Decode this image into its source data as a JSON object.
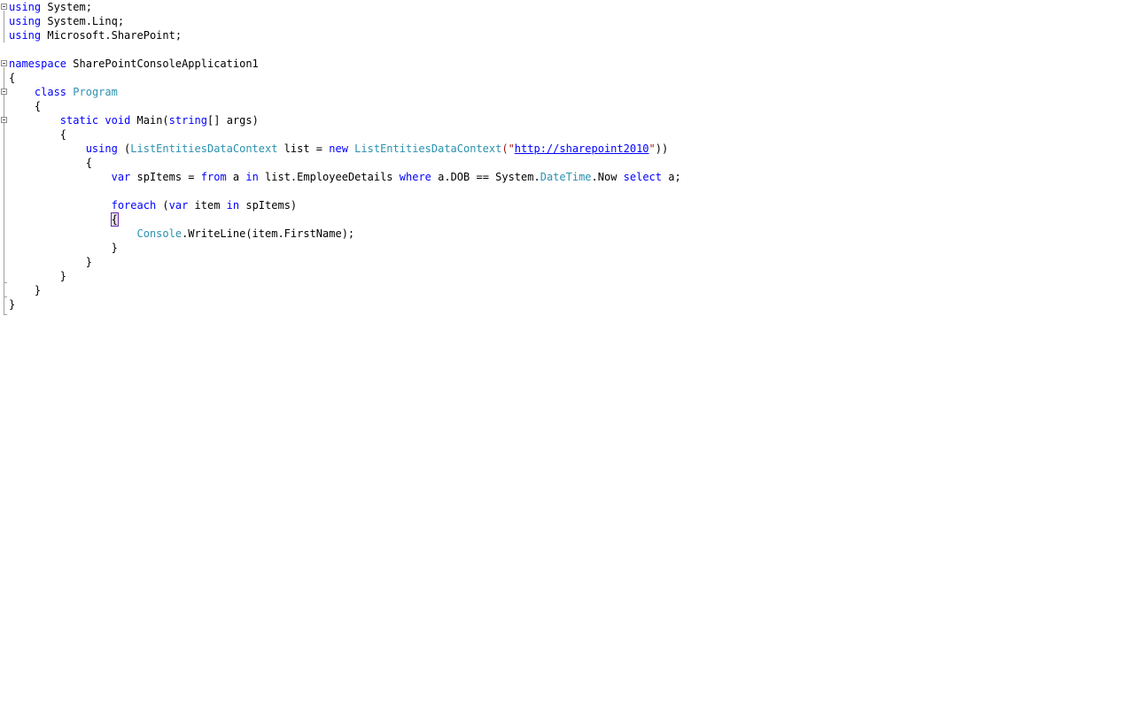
{
  "editor": {
    "lines": [
      {
        "indent": "",
        "tokens": [
          {
            "t": "using",
            "c": "kw"
          },
          {
            "t": " System;",
            "c": ""
          }
        ]
      },
      {
        "indent": "",
        "tokens": [
          {
            "t": "using",
            "c": "kw"
          },
          {
            "t": " System.Linq;",
            "c": ""
          }
        ]
      },
      {
        "indent": "",
        "tokens": [
          {
            "t": "using",
            "c": "kw"
          },
          {
            "t": " Microsoft.SharePoint;",
            "c": ""
          }
        ]
      },
      {
        "indent": "",
        "tokens": []
      },
      {
        "indent": "",
        "tokens": [
          {
            "t": "namespace",
            "c": "kw"
          },
          {
            "t": " SharePointConsoleApplication1",
            "c": ""
          }
        ]
      },
      {
        "indent": "",
        "tokens": [
          {
            "t": "{",
            "c": ""
          }
        ]
      },
      {
        "indent": "    ",
        "tokens": [
          {
            "t": "class",
            "c": "kw"
          },
          {
            "t": " ",
            "c": ""
          },
          {
            "t": "Program",
            "c": "ty"
          }
        ]
      },
      {
        "indent": "    ",
        "tokens": [
          {
            "t": "{",
            "c": ""
          }
        ]
      },
      {
        "indent": "        ",
        "tokens": [
          {
            "t": "static",
            "c": "kw"
          },
          {
            "t": " ",
            "c": ""
          },
          {
            "t": "void",
            "c": "kw"
          },
          {
            "t": " Main(",
            "c": ""
          },
          {
            "t": "string",
            "c": "kw"
          },
          {
            "t": "[] args)",
            "c": ""
          }
        ]
      },
      {
        "indent": "        ",
        "tokens": [
          {
            "t": "{",
            "c": ""
          }
        ]
      },
      {
        "indent": "            ",
        "tokens": [
          {
            "t": "using",
            "c": "kw"
          },
          {
            "t": " (",
            "c": ""
          },
          {
            "t": "ListEntitiesDataContext",
            "c": "ty"
          },
          {
            "t": " list = ",
            "c": ""
          },
          {
            "t": "new",
            "c": "kw"
          },
          {
            "t": " ",
            "c": ""
          },
          {
            "t": "ListEntitiesDataContext",
            "c": "ty"
          },
          {
            "t": "(\"",
            "c": "str"
          },
          {
            "t": "http://sharepoint2010",
            "c": "url"
          },
          {
            "t": "\"",
            "c": "str"
          },
          {
            "t": "))",
            "c": ""
          }
        ]
      },
      {
        "indent": "            ",
        "tokens": [
          {
            "t": "{",
            "c": ""
          }
        ]
      },
      {
        "indent": "                ",
        "tokens": [
          {
            "t": "var",
            "c": "kw"
          },
          {
            "t": " spItems = ",
            "c": ""
          },
          {
            "t": "from",
            "c": "kw"
          },
          {
            "t": " a ",
            "c": ""
          },
          {
            "t": "in",
            "c": "kw"
          },
          {
            "t": " list.EmployeeDetails ",
            "c": ""
          },
          {
            "t": "where",
            "c": "kw"
          },
          {
            "t": " a.DOB == System.",
            "c": ""
          },
          {
            "t": "DateTime",
            "c": "ty"
          },
          {
            "t": ".Now ",
            "c": ""
          },
          {
            "t": "select",
            "c": "kw"
          },
          {
            "t": " a;",
            "c": ""
          }
        ]
      },
      {
        "indent": "",
        "tokens": []
      },
      {
        "indent": "                ",
        "tokens": [
          {
            "t": "foreach",
            "c": "kw"
          },
          {
            "t": " (",
            "c": ""
          },
          {
            "t": "var",
            "c": "kw"
          },
          {
            "t": " item ",
            "c": ""
          },
          {
            "t": "in",
            "c": "kw"
          },
          {
            "t": " spItems)",
            "c": ""
          }
        ]
      },
      {
        "indent": "                ",
        "tokens": [
          {
            "t": "{",
            "c": "brace-hl"
          }
        ]
      },
      {
        "indent": "                    ",
        "tokens": [
          {
            "t": "Console",
            "c": "ty"
          },
          {
            "t": ".WriteLine(item.FirstName);",
            "c": ""
          }
        ]
      },
      {
        "indent": "                ",
        "tokens": [
          {
            "t": "}",
            "c": ""
          }
        ]
      },
      {
        "indent": "            ",
        "tokens": [
          {
            "t": "}",
            "c": ""
          }
        ]
      },
      {
        "indent": "        ",
        "tokens": [
          {
            "t": "}",
            "c": ""
          }
        ]
      },
      {
        "indent": "    ",
        "tokens": [
          {
            "t": "}",
            "c": ""
          }
        ]
      },
      {
        "indent": "",
        "tokens": [
          {
            "t": "}",
            "c": ""
          }
        ]
      }
    ]
  },
  "colors": {
    "keyword": "#0000ff",
    "type": "#2b91af",
    "string": "#a31515",
    "text": "#000000",
    "background": "#ffffff"
  },
  "icons": {
    "fold": "collapse-outline-icon"
  }
}
